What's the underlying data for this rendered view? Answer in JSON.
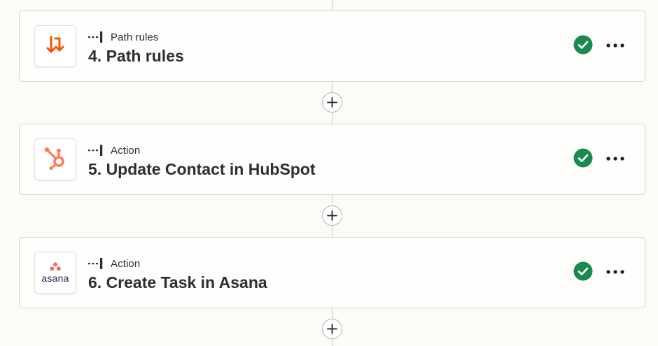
{
  "colors": {
    "background": "#fcfbf8",
    "card_border": "#d7d4ce",
    "check_green": "#1a8a4f",
    "path_orange": "#ff4f00",
    "hubspot_orange": "#ff7a59",
    "asana_coral": "#f06a6a"
  },
  "steps": [
    {
      "type_label": "Path rules",
      "title": "4. Path rules",
      "app_icon": "path-rules-icon",
      "status_icon": "check-circle-icon"
    },
    {
      "type_label": "Action",
      "title": "5. Update Contact in HubSpot",
      "app_icon": "hubspot-icon",
      "status_icon": "check-circle-icon"
    },
    {
      "type_label": "Action",
      "title": "6. Create Task in Asana",
      "app_icon": "asana-icon",
      "app_logo_text": "asana",
      "status_icon": "check-circle-icon"
    }
  ]
}
